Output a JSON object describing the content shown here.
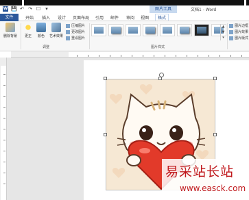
{
  "app": {
    "doc_title": "文档1 - Word",
    "quick_access": [
      "W",
      "💾",
      "↶",
      "↷",
      "☐",
      "▾"
    ],
    "context_group": "图片工具"
  },
  "tabs": [
    {
      "label": "文件",
      "kind": "file"
    },
    {
      "label": "开始"
    },
    {
      "label": "插入"
    },
    {
      "label": "设计"
    },
    {
      "label": "页面布局"
    },
    {
      "label": "引用"
    },
    {
      "label": "邮件"
    },
    {
      "label": "审阅"
    },
    {
      "label": "视图"
    },
    {
      "label": "格式",
      "kind": "active"
    }
  ],
  "ribbon": {
    "remove_bg": "删除背景",
    "corrections": "更正",
    "color": "颜色",
    "artistic": "艺术效果",
    "compress": "压缩图片",
    "change": "更改图片",
    "reset": "重设图片",
    "adjust_group": "调整",
    "styles_group": "图片样式",
    "border": "图片边框",
    "effects": "图片效果",
    "layout": "图片版式"
  },
  "watermark": {
    "chinese": "易采站长站",
    "url": "www.easck.com"
  },
  "colors": {
    "word_blue": "#2b579a",
    "ribbon_bg": "#f7f7f7",
    "context_tab": "#c7d9ef",
    "watermark_red": "#c0181c"
  }
}
